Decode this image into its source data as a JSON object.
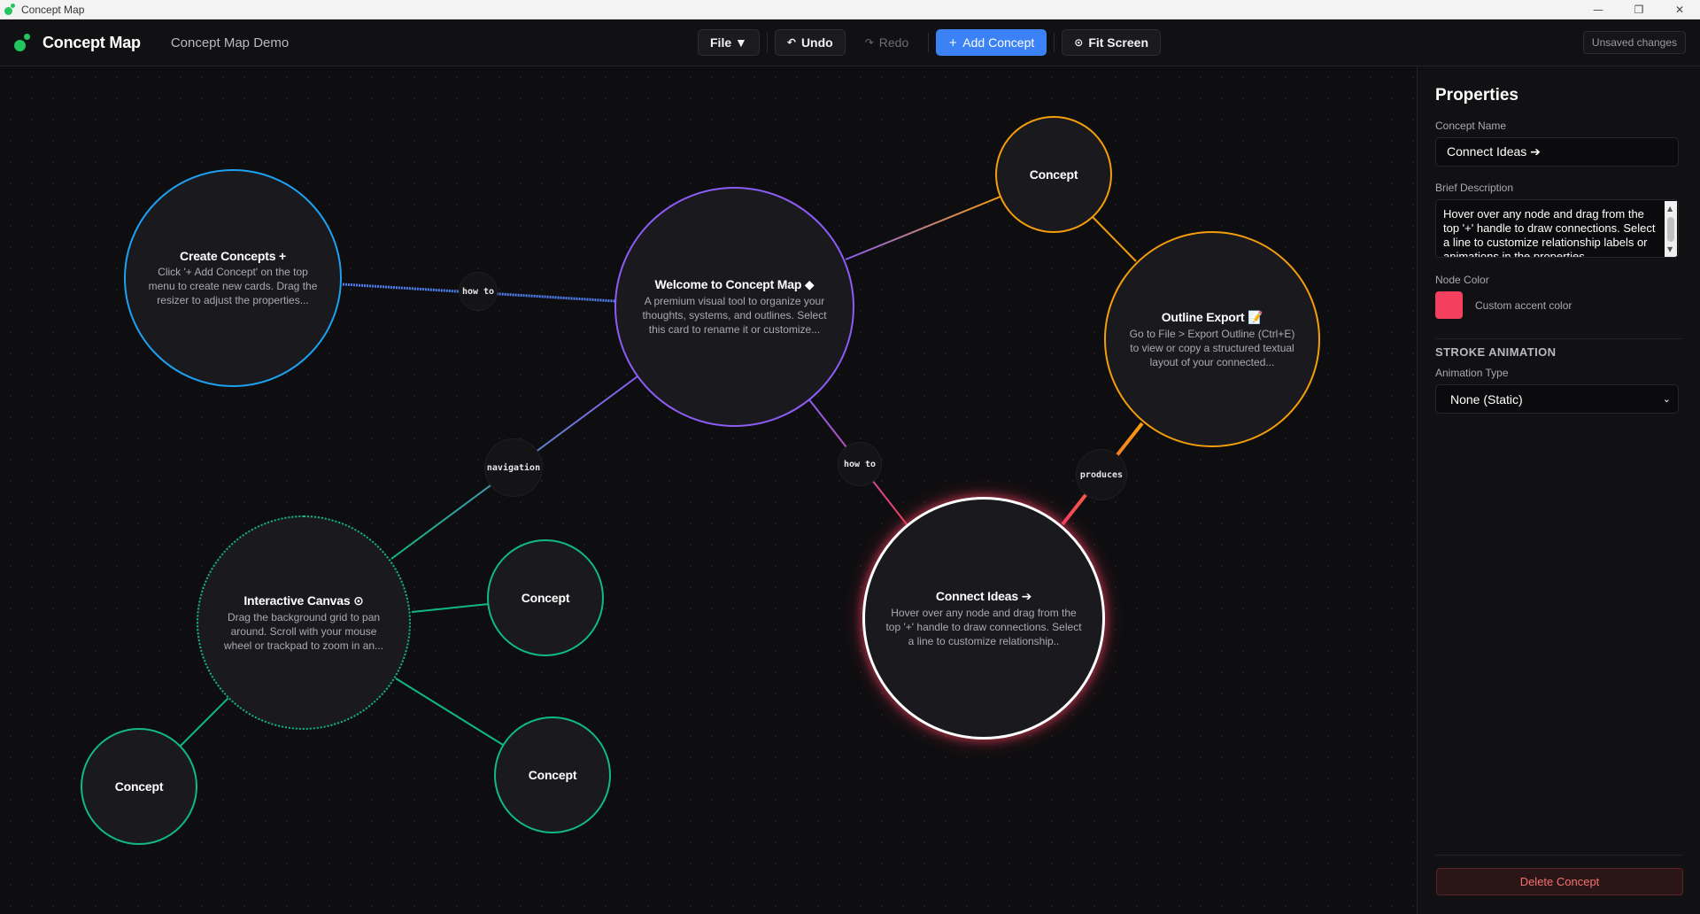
{
  "window": {
    "title": "Concept Map",
    "controls": [
      "—",
      "❐",
      "✕"
    ]
  },
  "header": {
    "brand": "Concept Map",
    "document_title": "Concept Map Demo",
    "file_label": "File ▼",
    "undo_label": "Undo",
    "redo_label": "Redo",
    "add_concept_label": "Add Concept",
    "fit_screen_label": "Fit Screen",
    "unsaved_label": "Unsaved changes",
    "icons": {
      "undo": "↶",
      "redo": "↷",
      "add": "+",
      "fit": "⊙"
    }
  },
  "nodes": {
    "create": {
      "title": "Create Concepts +",
      "desc": "Click '+ Add Concept' on the top menu to create new cards. Drag the resizer to adjust the properties...",
      "color": "#1da1f2"
    },
    "welcome": {
      "title": "Welcome to Concept Map ◆",
      "desc": "A premium visual tool to organize your thoughts, systems, and outlines. Select this card to rename it or customize...",
      "color": "#8b5cf6"
    },
    "concept_top": {
      "title": "Concept",
      "color": "#f59e0b"
    },
    "outline": {
      "title": "Outline Export 📝",
      "desc": "Go to File > Export Outline (Ctrl+E) to view or copy a structured textual layout of your connected...",
      "color": "#f59e0b"
    },
    "canvas_node": {
      "title": "Interactive Canvas ⊙",
      "desc": "Drag the background grid to pan around. Scroll with your mouse wheel or trackpad to zoom in an...",
      "color": "#10b981"
    },
    "concept_mid": {
      "title": "Concept",
      "color": "#10b981"
    },
    "concept_bl": {
      "title": "Concept",
      "color": "#10b981"
    },
    "concept_br": {
      "title": "Concept",
      "color": "#10b981"
    },
    "connect": {
      "title": "Connect Ideas ➔",
      "desc": "Hover over any node and drag from the top '+' handle to draw connections. Select a line to customize relationship..",
      "color": "#ffffff"
    }
  },
  "edge_labels": {
    "howto_left": "how to",
    "navigation": "navigation",
    "howto_mid": "how to",
    "produces": "produces"
  },
  "properties": {
    "title": "Properties",
    "name_label": "Concept Name",
    "name_value": "Connect Ideas ➔",
    "desc_label": "Brief Description",
    "desc_value": "Hover over any node and drag from the top '+' handle to draw connections. Select a line to customize relationship labels or animations in the properties",
    "color_label": "Node Color",
    "color_value": "#f43f5e",
    "color_hint": "Custom accent color",
    "stroke_section": "STROKE ANIMATION",
    "anim_label": "Animation Type",
    "anim_value": "None (Static)",
    "delete_label": "Delete Concept"
  }
}
